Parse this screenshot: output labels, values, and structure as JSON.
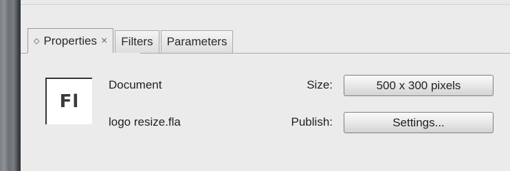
{
  "tabs": [
    {
      "label": "Properties",
      "active": true,
      "icon": "collapse-arrows-icon",
      "close": "×"
    },
    {
      "label": "Filters"
    },
    {
      "label": "Parameters"
    }
  ],
  "document": {
    "icon_text": "Fl",
    "type_label": "Document",
    "filename": "logo resize.fla"
  },
  "size": {
    "label": "Size:",
    "button": "500 x 300 pixels"
  },
  "publish": {
    "label": "Publish:",
    "button": "Settings..."
  }
}
